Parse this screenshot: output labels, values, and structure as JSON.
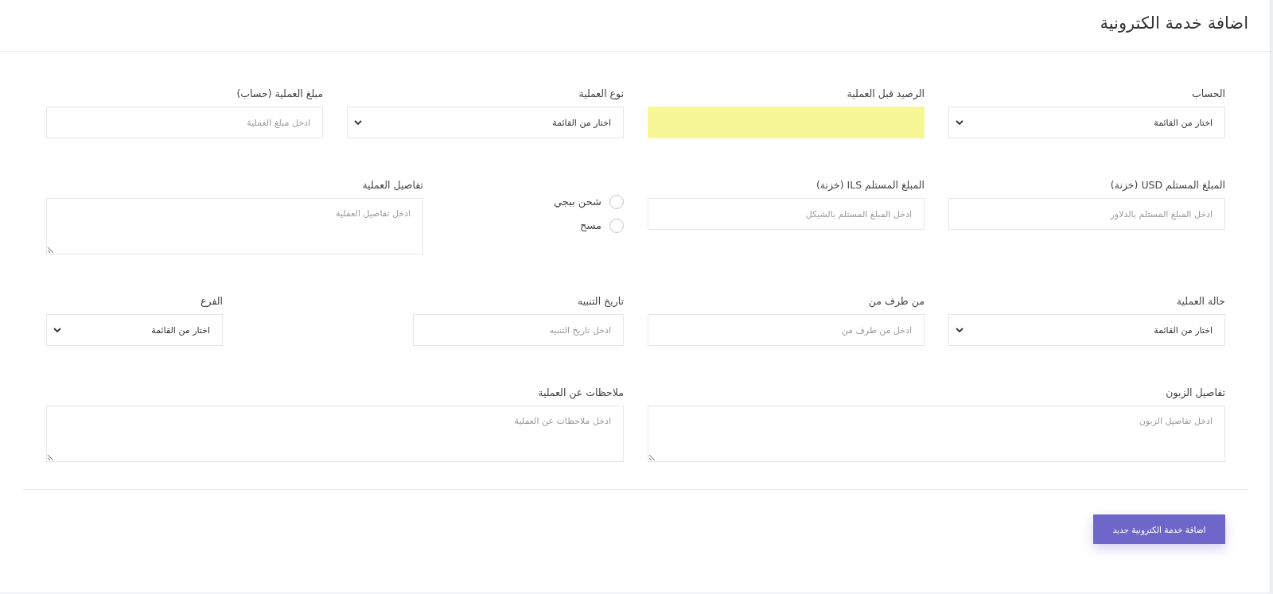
{
  "page": {
    "title": "اضافة خدمة الكترونية"
  },
  "form": {
    "rows": [
      {
        "fields": [
          {
            "kind": "select",
            "label": "الحساب",
            "value": "اختار من القائمة"
          },
          {
            "kind": "input",
            "label": "الرصيد قبل العملية",
            "highlighted": true
          },
          {
            "kind": "select",
            "label": "نوع العملية",
            "value": "اختار من القائمة"
          },
          {
            "kind": "input",
            "label": "مبلغ العملية (حساب)",
            "placeholder": "ادخل مبلغ العملية",
            "highlighted": false
          }
        ]
      },
      {
        "fields": [
          {
            "kind": "input",
            "label": "المبلغ المستلم USD (خزنة)",
            "placeholder": "ادخل المبلغ المستلم بالدلاور",
            "highlighted": false
          },
          {
            "kind": "input",
            "label": "المبلغ المستلم ILS (خزنة)",
            "placeholder": "ادخل المبلغ المستلم بالشيكل",
            "highlighted": false
          },
          {
            "kind": "radio_group",
            "options": [
              {
                "label": "شحن ببجي",
                "selected": false
              },
              {
                "label": "مسح",
                "selected": false
              }
            ]
          },
          {
            "kind": "textarea",
            "label": "تفاصيل العملية",
            "placeholder": "ادخل تفاصيل العملية"
          }
        ]
      },
      {
        "fields": [
          {
            "kind": "select",
            "label": "حالة العملية",
            "value": "اختار من القائمة"
          },
          {
            "kind": "input",
            "label": "من طرف من",
            "placeholder": "ادخل من طرف من",
            "highlighted": false
          },
          {
            "kind": "input",
            "label": "تاريخ التنبيه",
            "placeholder": "ادخل تاريخ التنبيه",
            "highlighted": false
          },
          {
            "kind": "select",
            "label": "الفرع",
            "value": "اختار من القائمة"
          }
        ]
      },
      {
        "fields": [
          {
            "kind": "textarea",
            "label": "تفاصيل الزبون",
            "placeholder": "ادخل تفاصيل الزبون"
          },
          {
            "kind": "textarea",
            "label": "ملاحظات عن العملية",
            "placeholder": "ادخل ملاحظات عن العملية"
          }
        ]
      }
    ]
  },
  "submit_button": {
    "label": "اضافة خدمة الكترونية جديد"
  }
}
